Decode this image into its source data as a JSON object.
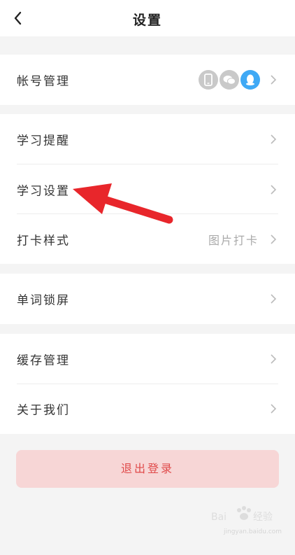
{
  "header": {
    "title": "设置",
    "back_icon": "chevron-left-icon"
  },
  "groups": [
    {
      "items": [
        {
          "label": "帐号管理",
          "icons": [
            "phone-icon",
            "wechat-icon",
            "qq-icon"
          ]
        }
      ]
    },
    {
      "items": [
        {
          "label": "学习提醒"
        },
        {
          "label": "学习设置"
        },
        {
          "label": "打卡样式",
          "value": "图片打卡"
        }
      ]
    },
    {
      "items": [
        {
          "label": "单词锁屏"
        }
      ]
    },
    {
      "items": [
        {
          "label": "缓存管理"
        },
        {
          "label": "关于我们"
        }
      ]
    }
  ],
  "logout": {
    "label": "退出登录"
  },
  "annotation": {
    "arrow_color": "#e8262b"
  },
  "watermark": {
    "text": "jingyan.baidu.com"
  },
  "colors": {
    "logout_bg": "#f7d6d6",
    "logout_text": "#e04a4a",
    "qq_blue": "#3fa9f5"
  }
}
